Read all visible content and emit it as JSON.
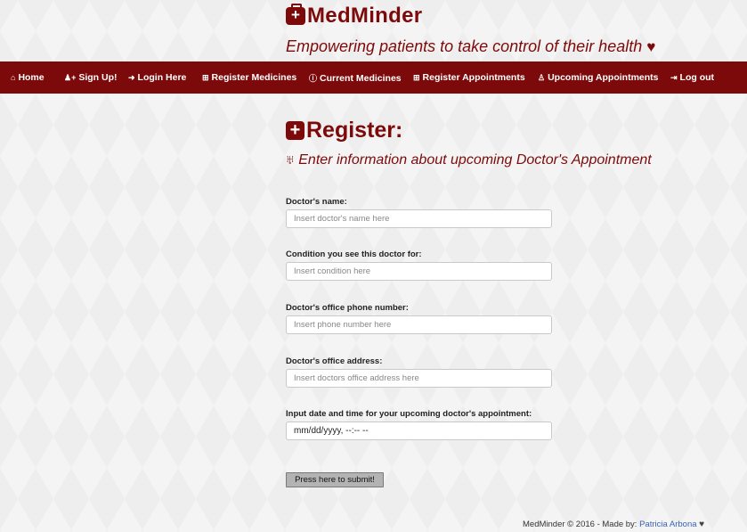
{
  "brand": {
    "name": "MedMinder",
    "tagline": "Empowering patients to take control of their health"
  },
  "nav": [
    {
      "label": "Home",
      "icon": "home-icon",
      "glyph": "⌂"
    },
    {
      "label": "Sign Up!",
      "icon": "user-plus-icon",
      "glyph": "👤"
    },
    {
      "label": "Login Here",
      "icon": "sign-in-icon",
      "glyph": "➜"
    },
    {
      "label": "Register Medicines",
      "icon": "plus-square-icon",
      "glyph": "⊞"
    },
    {
      "label": "Current Medicines",
      "icon": "info-circle-icon",
      "glyph": "ⓘ"
    },
    {
      "label": "Register Appointments",
      "icon": "plus-square-icon",
      "glyph": "⊞"
    },
    {
      "label": "Upcoming Appointments",
      "icon": "user-md-icon",
      "glyph": "♙"
    },
    {
      "label": "Log out",
      "icon": "sign-out-icon",
      "glyph": "⇥"
    }
  ],
  "page": {
    "title": "Register:",
    "subtitle": "Enter information about upcoming Doctor's Appointment"
  },
  "form": {
    "doctor_name": {
      "label": "Doctor's name:",
      "placeholder": "Insert doctor's name here"
    },
    "condition": {
      "label": "Condition you see this doctor for:",
      "placeholder": "Insert condition here"
    },
    "phone": {
      "label": "Doctor's office phone number:",
      "placeholder": "Insert phone number here"
    },
    "address": {
      "label": "Doctor's office address:",
      "placeholder": "Insert doctors office address here"
    },
    "datetime": {
      "label": "Input date and time for your upcoming doctor's appointment:",
      "value": "mm/dd/yyyy, --:-- --"
    },
    "submit_label": "Press here to submit!"
  },
  "footer": {
    "text": "MedMinder © 2016 - Made by:",
    "author": "Patricia Arbona"
  },
  "colors": {
    "brand": "#7d0a0a",
    "link": "#3a63b8"
  }
}
